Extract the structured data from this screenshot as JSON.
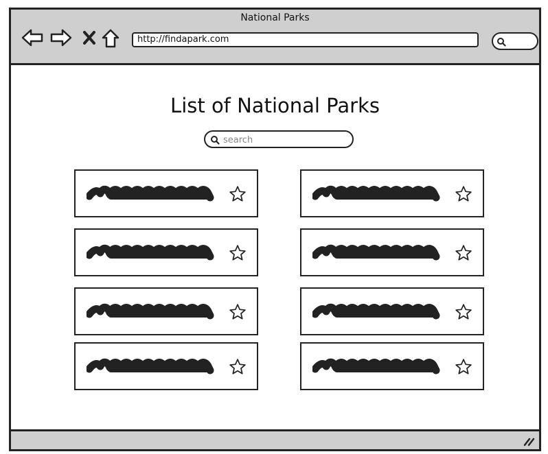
{
  "window": {
    "title": "National Parks"
  },
  "browser": {
    "url": "http://findapark.com",
    "nav_icons": [
      "back-arrow-icon",
      "forward-arrow-icon",
      "close-x-icon",
      "home-icon"
    ],
    "search_icon": "search-icon"
  },
  "page": {
    "title": "List of National Parks",
    "search": {
      "placeholder": "search",
      "value": ""
    }
  },
  "parks": [
    {
      "column": "left",
      "favorite_icon": "star-outline-icon"
    },
    {
      "column": "right",
      "favorite_icon": "star-outline-icon"
    },
    {
      "column": "left",
      "favorite_icon": "star-outline-icon"
    },
    {
      "column": "right",
      "favorite_icon": "star-outline-icon"
    },
    {
      "column": "left",
      "favorite_icon": "star-outline-icon"
    },
    {
      "column": "right",
      "favorite_icon": "star-outline-icon"
    },
    {
      "column": "left",
      "favorite_icon": "star-outline-icon"
    },
    {
      "column": "right",
      "favorite_icon": "star-outline-icon"
    }
  ],
  "colors": {
    "chrome": "#cfcfcf",
    "ink": "#222222",
    "background": "#ffffff"
  }
}
